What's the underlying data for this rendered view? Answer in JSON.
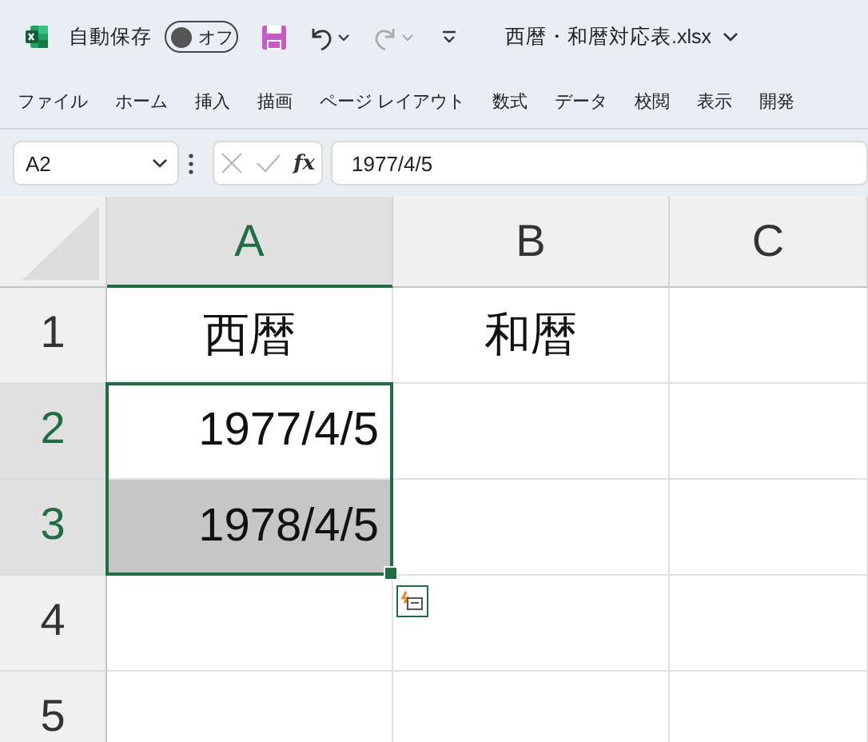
{
  "title_bar": {
    "autosave_label": "自動保存",
    "autosave": {
      "on": false,
      "label": "オフ"
    },
    "file_name": "西暦・和暦対応表.xlsx"
  },
  "ribbon_tabs": [
    "ファイル",
    "ホーム",
    "挿入",
    "描画",
    "ページ レイアウト",
    "数式",
    "データ",
    "校閲",
    "表示",
    "開発"
  ],
  "formula_bar": {
    "name_box": "A2",
    "function_label": "fx",
    "formula": "1977/4/5"
  },
  "sheet": {
    "columns": [
      {
        "label": "A",
        "selected": true
      },
      {
        "label": "B",
        "selected": false
      },
      {
        "label": "C",
        "selected": false
      }
    ],
    "rows": [
      {
        "label": "1",
        "selected": false,
        "cells": [
          {
            "text": "西暦",
            "kind": "text",
            "highlighted": false
          },
          {
            "text": "和暦",
            "kind": "text",
            "highlighted": false
          }
        ]
      },
      {
        "label": "2",
        "selected": true,
        "cells": [
          {
            "text": "1977/4/5",
            "kind": "date",
            "highlighted": false
          }
        ]
      },
      {
        "label": "3",
        "selected": true,
        "cells": [
          {
            "text": "1978/4/5",
            "kind": "date",
            "highlighted": true
          }
        ]
      },
      {
        "label": "4",
        "selected": false
      },
      {
        "label": "5",
        "selected": false
      }
    ]
  }
}
